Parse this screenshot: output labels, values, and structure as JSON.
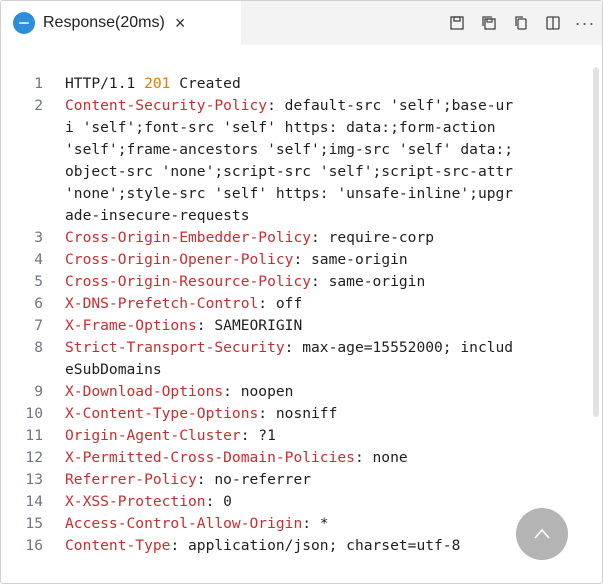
{
  "tab": {
    "title": "Response(20ms)",
    "close": "×"
  },
  "actions": {
    "more": "···"
  },
  "lines": [
    {
      "n": "1",
      "key": "",
      "rest": "HTTP/1.1 ",
      "status": "201",
      "after": " Created"
    },
    {
      "n": "2",
      "key": "Content-Security-Policy",
      "rest": ": default-src 'self';base-ur"
    },
    {
      "n": "",
      "key": "",
      "rest": "i 'self';font-src 'self' https: data:;form-action"
    },
    {
      "n": "",
      "key": "",
      "rest": "'self';frame-ancestors 'self';img-src 'self' data:;"
    },
    {
      "n": "",
      "key": "",
      "rest": "object-src 'none';script-src 'self';script-src-attr"
    },
    {
      "n": "",
      "key": "",
      "rest": "'none';style-src 'self' https: 'unsafe-inline';upgr"
    },
    {
      "n": "",
      "key": "",
      "rest": "ade-insecure-requests"
    },
    {
      "n": "3",
      "key": "Cross-Origin-Embedder-Policy",
      "rest": ": require-corp"
    },
    {
      "n": "4",
      "key": "Cross-Origin-Opener-Policy",
      "rest": ": same-origin"
    },
    {
      "n": "5",
      "key": "Cross-Origin-Resource-Policy",
      "rest": ": same-origin"
    },
    {
      "n": "6",
      "key": "X-DNS-Prefetch-Control",
      "rest": ": off"
    },
    {
      "n": "7",
      "key": "X-Frame-Options",
      "rest": ": SAMEORIGIN"
    },
    {
      "n": "8",
      "key": "Strict-Transport-Security",
      "rest": ": max-age=15552000; includ"
    },
    {
      "n": "",
      "key": "",
      "rest": "eSubDomains"
    },
    {
      "n": "9",
      "key": "X-Download-Options",
      "rest": ": noopen"
    },
    {
      "n": "10",
      "key": "X-Content-Type-Options",
      "rest": ": nosniff"
    },
    {
      "n": "11",
      "key": "Origin-Agent-Cluster",
      "rest": ": ?1"
    },
    {
      "n": "12",
      "key": "X-Permitted-Cross-Domain-Policies",
      "rest": ": none"
    },
    {
      "n": "13",
      "key": "Referrer-Policy",
      "rest": ": no-referrer"
    },
    {
      "n": "14",
      "key": "X-XSS-Protection",
      "rest": ": 0"
    },
    {
      "n": "15",
      "key": "Access-Control-Allow-Origin",
      "rest": ": *"
    },
    {
      "n": "16",
      "key": "Content-Type",
      "rest": ": application/json; charset=utf-8"
    }
  ]
}
